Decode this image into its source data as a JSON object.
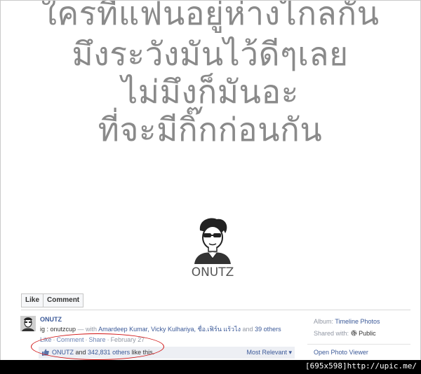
{
  "quote_lines": [
    "ใครที่แฟนอยู่ห่างไกลกัน",
    "มึงระวังมันไว้ดีๆเลย",
    "ไม่มึงก็มันอะ",
    "ที่จะมีกิ๊กก่อนกัน"
  ],
  "brand": "ONUTZ",
  "actions": {
    "like": "Like",
    "comment": "Comment"
  },
  "post": {
    "author": "ONUTZ",
    "caption": "ig : onutzcup",
    "with_prefix": " — with ",
    "tagged": "Amardeep Kumar, Vicky Kulhariya, ชื่อ.เฟิร์น แร้วไง",
    "and_text": " and ",
    "others": "39 others",
    "footer": {
      "like": "Like",
      "comment": "Comment",
      "share": "Share",
      "sep": "·",
      "date": "February 27"
    },
    "likes": {
      "name": "ONUTZ",
      "and_text": " and ",
      "count": "342,831 others",
      "suffix": " like this.",
      "sort": "Most Relevant ▾"
    }
  },
  "side": {
    "album_label": "Album:",
    "album_value": "Timeline Photos",
    "shared_label": "Shared with:",
    "shared_value": "Public",
    "open_viewer": "Open Photo Viewer"
  },
  "watermark": "[695x598]http://upic.me/",
  "colors": {
    "link": "#3b5998",
    "highlight_circle": "#d01010",
    "quote_text": "#8a8a8a"
  }
}
